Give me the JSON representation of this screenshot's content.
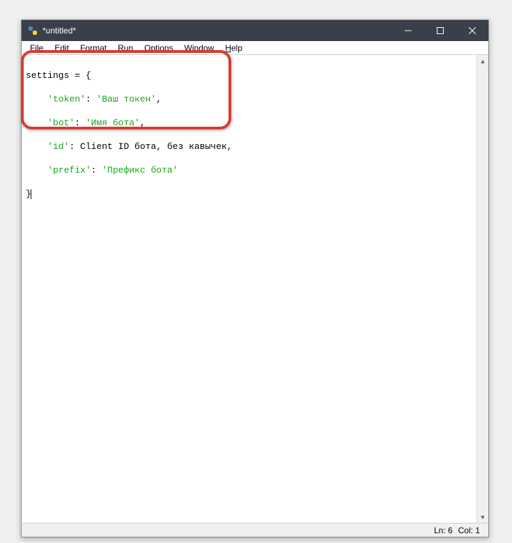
{
  "titlebar": {
    "title": "*untitled*"
  },
  "menu": {
    "file": "File",
    "edit": "Edit",
    "format": "Format",
    "run": "Run",
    "options": "Options",
    "window": "Window",
    "help": "Help"
  },
  "code": {
    "line1_a": "settings = {",
    "line2_key": "'token'",
    "line2_colon": ": ",
    "line2_val": "'Ваш токен'",
    "line2_comma": ",",
    "line3_key": "'bot'",
    "line3_colon": ": ",
    "line3_val": "'Имя бота'",
    "line3_comma": ",",
    "line4_key": "'id'",
    "line4_colon": ": ",
    "line4_val": "Client ID бота, без кавычек,",
    "line5_key": "'prefix'",
    "line5_colon": ": ",
    "line5_val": "'Префикс бота'",
    "line6": "}",
    "indent": "    "
  },
  "status": {
    "ln": "Ln: 6",
    "col": "Col: 1"
  }
}
